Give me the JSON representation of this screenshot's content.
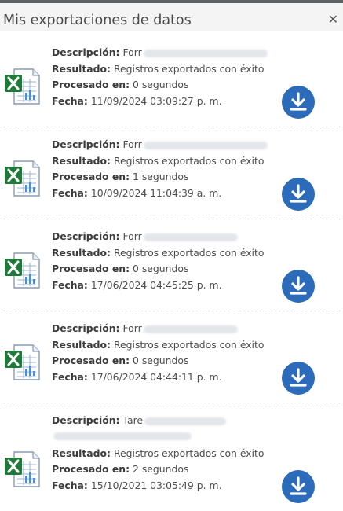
{
  "dialog": {
    "title": "Mis exportaciones de datos",
    "close_icon": "close-icon",
    "close_glyph": "✕"
  },
  "labels": {
    "description": "Descripción:",
    "result": "Resultado:",
    "processed": "Procesado en:",
    "date": "Fecha:"
  },
  "items": [
    {
      "description": "Forr",
      "result": "Registros exportados con éxito",
      "processed": "0 segundos",
      "date": "11/09/2024 03:09:27 p. m.",
      "file_icon": "excel-file-icon",
      "action_icon": "download-icon"
    },
    {
      "description": "Forr",
      "result": "Registros exportados con éxito",
      "processed": "1 segundos",
      "date": "10/09/2024 11:04:39 a. m.",
      "file_icon": "excel-file-icon",
      "action_icon": "download-icon"
    },
    {
      "description": "Forr",
      "result": "Registros exportados con éxito",
      "processed": "0 segundos",
      "date": "17/06/2024 04:45:25 p. m.",
      "file_icon": "excel-file-icon",
      "action_icon": "download-icon"
    },
    {
      "description": "Forr",
      "result": "Registros exportados con éxito",
      "processed": "0 segundos",
      "date": "17/06/2024 04:44:11 p. m.",
      "file_icon": "excel-file-icon",
      "action_icon": "download-icon"
    },
    {
      "description": "Tare",
      "result": "Registros exportados con éxito",
      "processed": "2 segundos",
      "date": "15/10/2021 03:05:49 p. m.",
      "file_icon": "excel-file-icon",
      "action_icon": "download-icon"
    }
  ],
  "colors": {
    "accent": "#2c6bb9",
    "excel_green": "#1f7a3a",
    "header_bg": "#f4f4f4"
  }
}
